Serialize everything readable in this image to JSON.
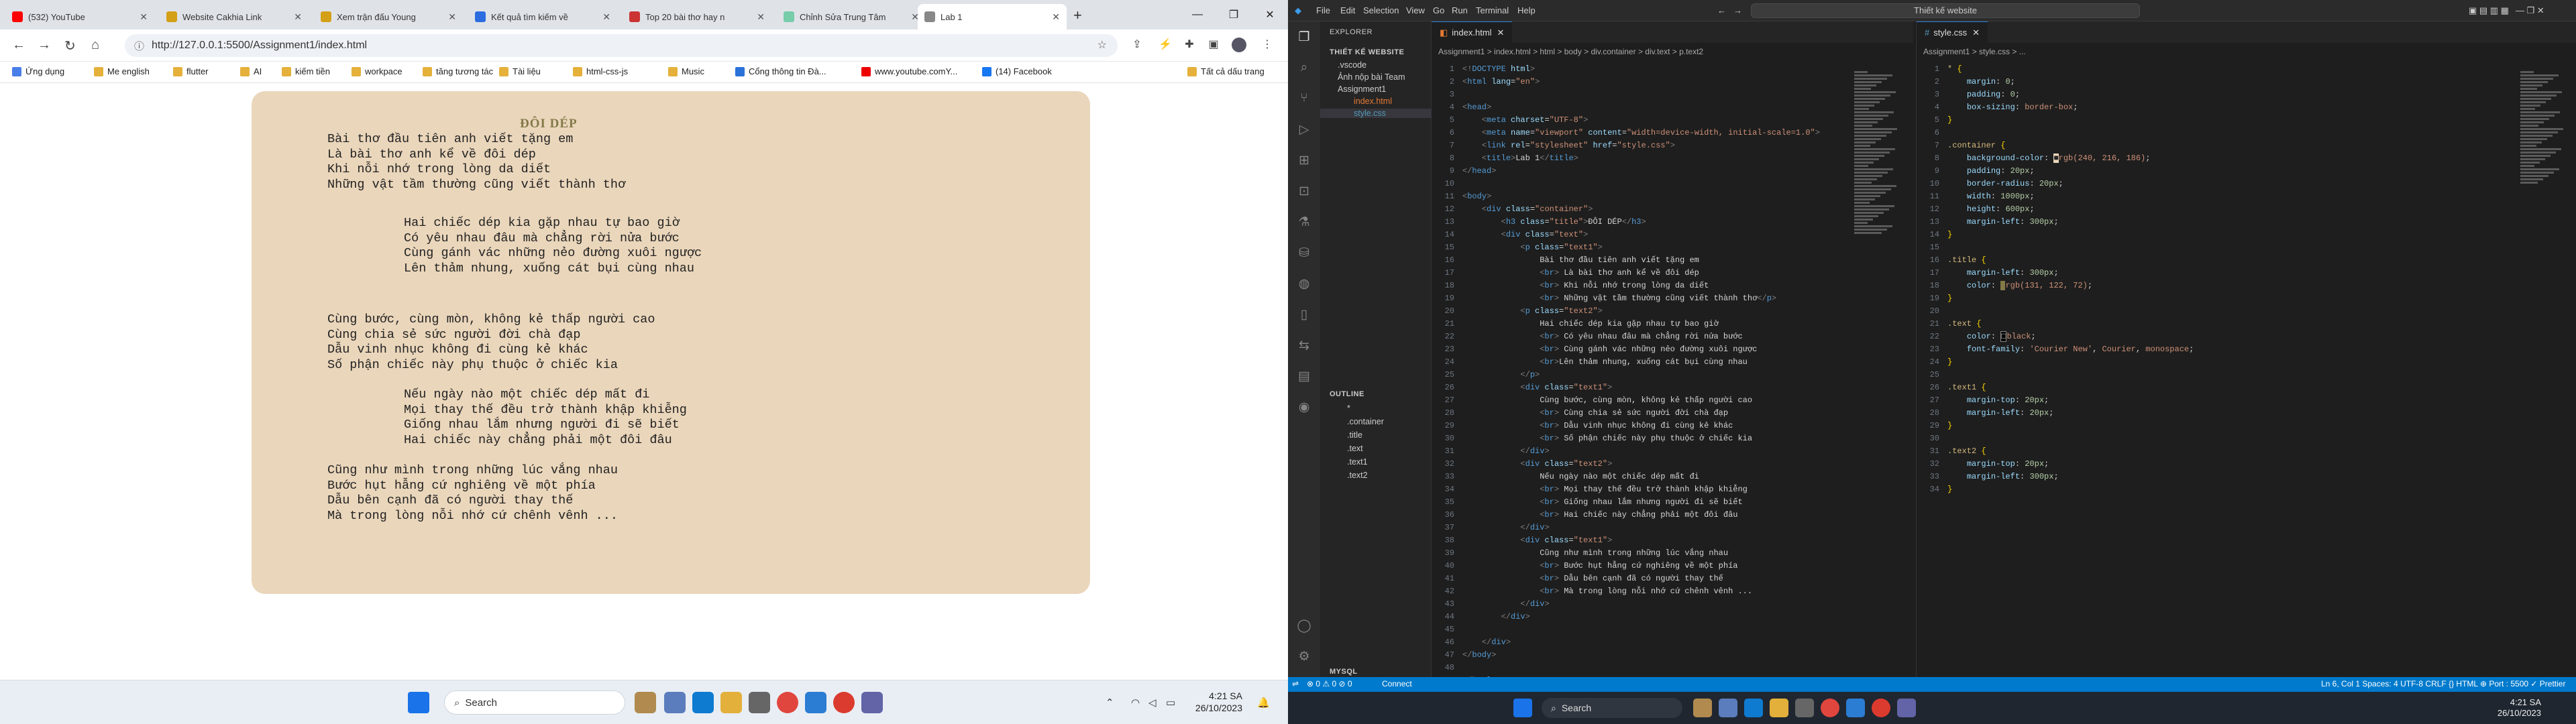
{
  "left": {
    "tabs": [
      {
        "label": "(532) YouTube",
        "color": "#ff0000"
      },
      {
        "label": "Website Cakhia Link",
        "color": "#d4a017"
      },
      {
        "label": "Xem trận đấu Young",
        "color": "#d4a017"
      },
      {
        "label": "Kết quả tìm kiếm về",
        "color": "#2b6de0"
      },
      {
        "label": "Top 20 bài thơ hay n",
        "color": "#c33"
      },
      {
        "label": "Chỉnh Sửa Trung Tâm",
        "color": "#7ca"
      },
      {
        "label": "Lab 1",
        "color": "#888"
      }
    ],
    "url": "http://127.0.0.1:5500/Assignment1/index.html",
    "bookmarks": [
      "Ứng dụng",
      "Me english",
      "flutter",
      "AI",
      "kiếm tiền",
      "workpace",
      "tăng tương tác",
      "Tài liệu",
      "html-css-js",
      "Music",
      "Cổng thông tin Đà...",
      "www.youtube.comY...",
      "(14) Facebook",
      "Tất cả dấu trang"
    ],
    "poem": {
      "title": "ĐÔI DÉP",
      "stanza1": [
        "Bài thơ đầu tiên anh viết tặng em",
        "Là bài thơ anh kể về đôi dép",
        "Khi nỗi nhớ trong lòng da diết",
        "Những vật tầm thường cũng viết thành thơ"
      ],
      "stanza2": [
        "Hai chiếc dép kia gặp nhau tự bao giờ",
        "Có yêu nhau đâu mà chẳng rời nửa bước",
        "Cùng gánh vác những nẻo đường xuôi ngược",
        "Lên thảm nhung, xuống cát bụi cùng nhau"
      ],
      "stanza3": [
        "Cùng bước, cùng mòn, không kẻ thấp người cao",
        "Cùng chia sẻ sức người đời chà đạp",
        "Dẫu vinh nhục không đi cùng kẻ khác",
        "Số phận chiếc này phụ thuộc ở chiếc kia"
      ],
      "stanza4": [
        "Nếu ngày nào một chiếc dép mất đi",
        "Mọi thay thế đều trở thành khập khiễng",
        "Giống nhau lắm nhưng người đi sẽ biết",
        "Hai chiếc này chẳng phải một đôi đâu"
      ],
      "stanza5": [
        "Cũng như mình trong những lúc vắng nhau",
        "Bước hụt hẫng cứ nghiêng về một phía",
        "Dẫu bên cạnh đã có người thay thế",
        "Mà trong lòng nỗi nhớ cứ chênh vênh ..."
      ]
    },
    "taskbar": {
      "search": "Search",
      "time": "4:21 SA",
      "date": "26/10/2023"
    }
  },
  "right": {
    "menu": [
      "File",
      "Edit",
      "Selection",
      "View",
      "Go",
      "Run",
      "Terminal",
      "Help"
    ],
    "search": "Thiết kế website",
    "explorer": {
      "header": "EXPLORER",
      "project": "THIẾT KẾ WEBSITE",
      "items": [
        ".vscode",
        "Ảnh nộp bài Team",
        "Assignment1",
        "index.html",
        "style.css"
      ],
      "outline": "OUTLINE",
      "outline_items": [
        "*",
        ".container",
        ".title",
        ".text",
        ".text1",
        ".text2"
      ],
      "mysql": "MYSQL"
    },
    "tab1": "index.html",
    "tab2": "style.css",
    "crumbs1": "Assignment1 > index.html > html > body > div.container > div.text > p.text2",
    "crumbs2": "Assignment1 > style.css > ...",
    "status": {
      "left": "⊗ 0 ⚠ 0   ⊘ 0",
      "connect": "Connect",
      "right": "Ln 6, Col 1   Spaces: 4   UTF-8   CRLF   {} HTML   ⊕ Port : 5500   ✓ Prettier"
    },
    "taskbar": {
      "search": "Search",
      "time": "4:21 SA",
      "date": "26/10/2023"
    }
  }
}
